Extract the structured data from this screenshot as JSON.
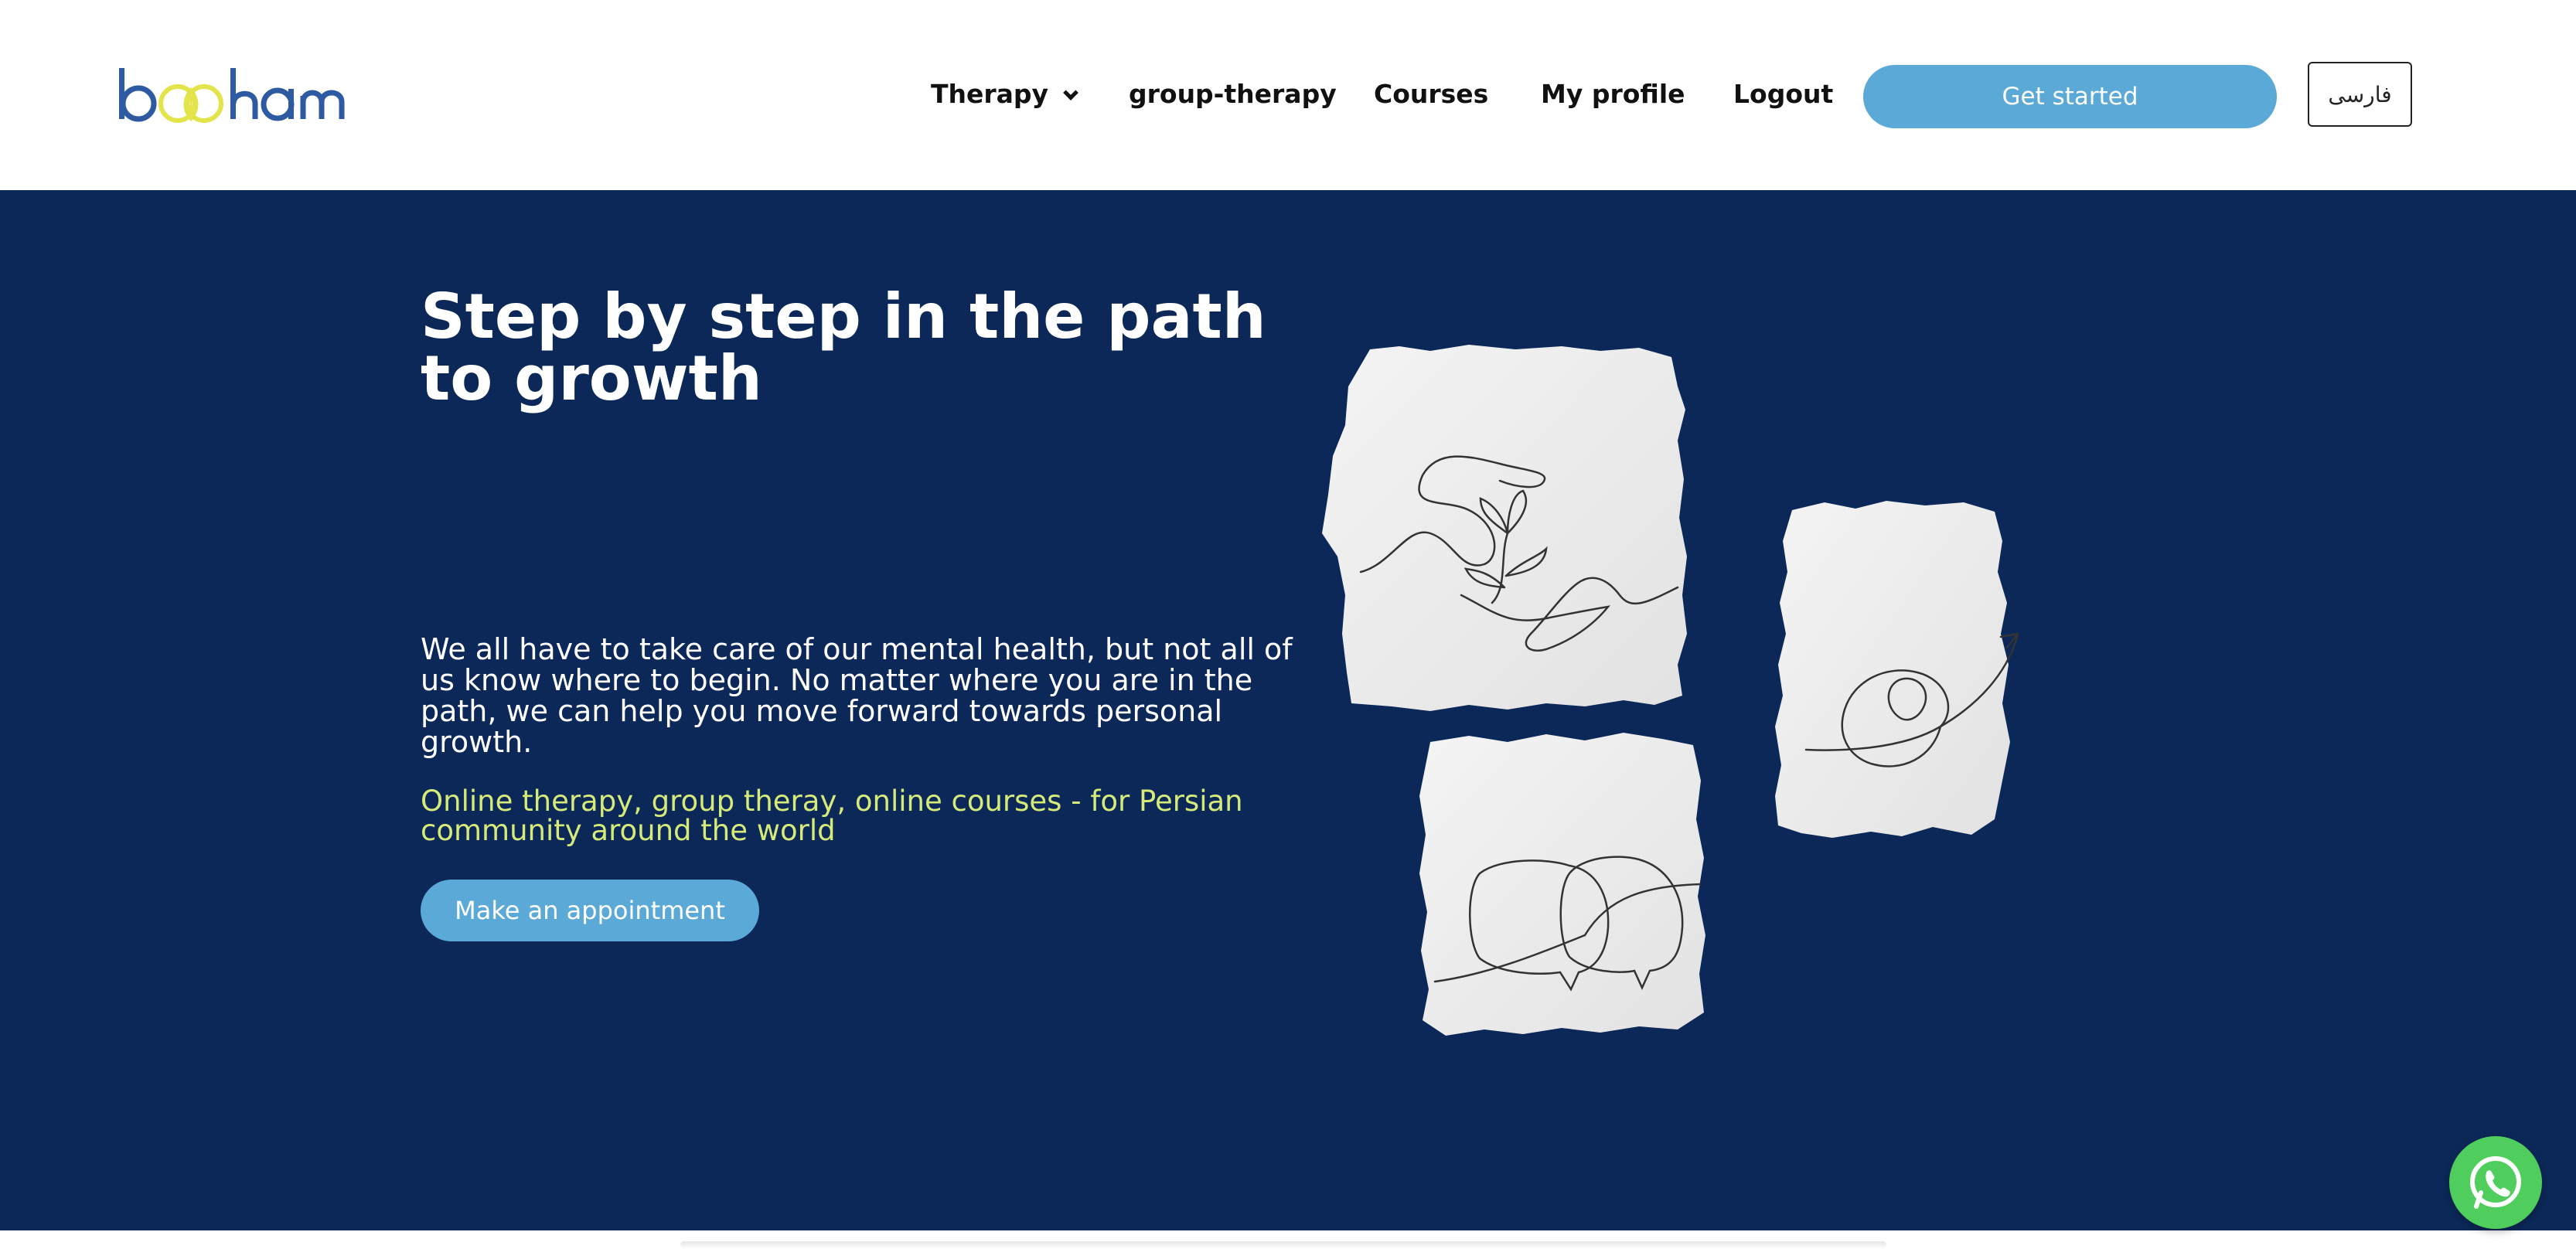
{
  "header": {
    "logo_text": "booham",
    "nav": {
      "therapy": "Therapy",
      "group_therapy": "group-therapy",
      "courses": "Courses",
      "my_profile": "My profile",
      "logout": "Logout"
    },
    "get_started": "Get started",
    "language": "فارسی"
  },
  "hero": {
    "title": "Step by step in the path to growth",
    "body": "We all have to take care of our mental health, but not all of us know where to begin. No matter where you are in the path, we can help you move forward towards personal growth.",
    "tagline": "Online therapy, group theray, online courses - for Persian community around the world",
    "cta": "Make an appointment",
    "illustrations": [
      "hand-plant-drawing",
      "spiral-arrow-drawing",
      "speech-bubbles-drawing"
    ]
  },
  "floating": {
    "whatsapp_icon": "whatsapp-icon"
  },
  "colors": {
    "navy": "#0b2858",
    "button_blue": "#5ba9d6",
    "tagline_yellow": "#d6ea7a",
    "logo_blue": "#2d5aa0",
    "logo_yellow": "#e3e34a",
    "whatsapp_green": "#4fce5d"
  }
}
